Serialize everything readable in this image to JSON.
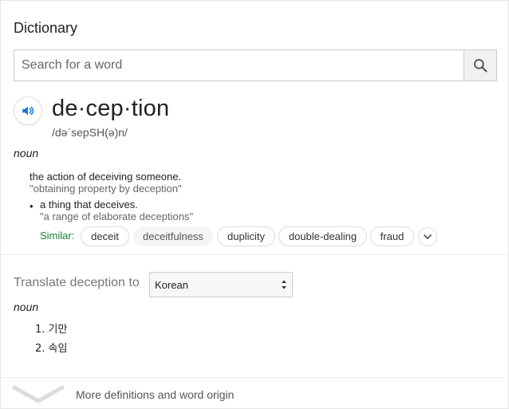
{
  "header": {
    "title": "Dictionary"
  },
  "search": {
    "placeholder": "Search for a word",
    "value": ""
  },
  "entry": {
    "word": "de·cep·tion",
    "phonetic": "/dəˈsepSH(ə)n/",
    "part_of_speech": "noun",
    "definitions": [
      {
        "text": "the action of deceiving someone.",
        "example": "\"obtaining property by deception\""
      },
      {
        "text": "a thing that deceives.",
        "example": "\"a range of elaborate deceptions\""
      }
    ],
    "similar_label": "Similar:",
    "similar": [
      "deceit",
      "deceitfulness",
      "duplicity",
      "double-dealing",
      "fraud"
    ]
  },
  "translate": {
    "label": "Translate deception to",
    "selected_language": "Korean",
    "part_of_speech": "noun",
    "items": [
      "1. 기만",
      "2. 속임"
    ]
  },
  "footer": {
    "more_label": "More definitions and word origin"
  },
  "colors": {
    "similar_label": "#188038",
    "speaker_icon": "#1a73e8"
  },
  "icons": {
    "search": "search-icon",
    "speaker": "speaker-icon",
    "expand": "chevron-down-icon",
    "more": "chevron-down-icon"
  }
}
